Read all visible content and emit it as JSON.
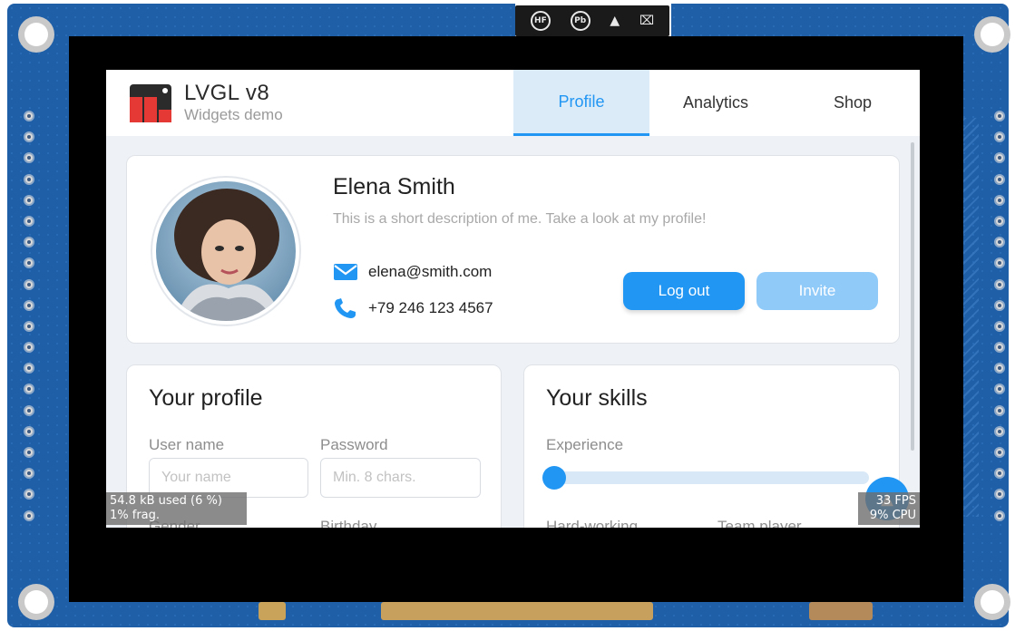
{
  "app": {
    "title": "LVGL v8",
    "subtitle": "Widgets demo"
  },
  "tabs": [
    {
      "label": "Profile",
      "active": true
    },
    {
      "label": "Analytics",
      "active": false
    },
    {
      "label": "Shop",
      "active": false
    }
  ],
  "profile_card": {
    "name": "Elena Smith",
    "description": "This is a short description of me. Take a look at my profile!",
    "email": "elena@smith.com",
    "phone": "+79 246 123 4567",
    "logout_label": "Log out",
    "invite_label": "Invite"
  },
  "your_profile": {
    "title": "Your profile",
    "username_label": "User name",
    "username_placeholder": "Your name",
    "password_label": "Password",
    "password_placeholder": "Min. 8 chars.",
    "gender_label": "Gender",
    "birthday_label": "Birthday"
  },
  "your_skills": {
    "title": "Your skills",
    "experience_label": "Experience",
    "experience_value": 0.0,
    "hard_working_label": "Hard-working",
    "team_player_label": "Team player"
  },
  "monitors": {
    "memory_line1": "54.8 kB used (6 %)",
    "memory_line2": "1% frag.",
    "perf_line1": "33 FPS",
    "perf_line2": "9% CPU"
  },
  "board": {
    "cert_hf": "HF",
    "cert_pb": "Pb"
  },
  "colors": {
    "primary": "#2196f3",
    "primary_light": "#90caf9",
    "board_blue": "#1f5fa8",
    "tab_active_bg": "#dcebf8"
  },
  "icons": {
    "email": "envelope-icon",
    "phone": "phone-icon",
    "fab": "arrow-up-icon",
    "logo": "lvgl-logo-icon"
  }
}
